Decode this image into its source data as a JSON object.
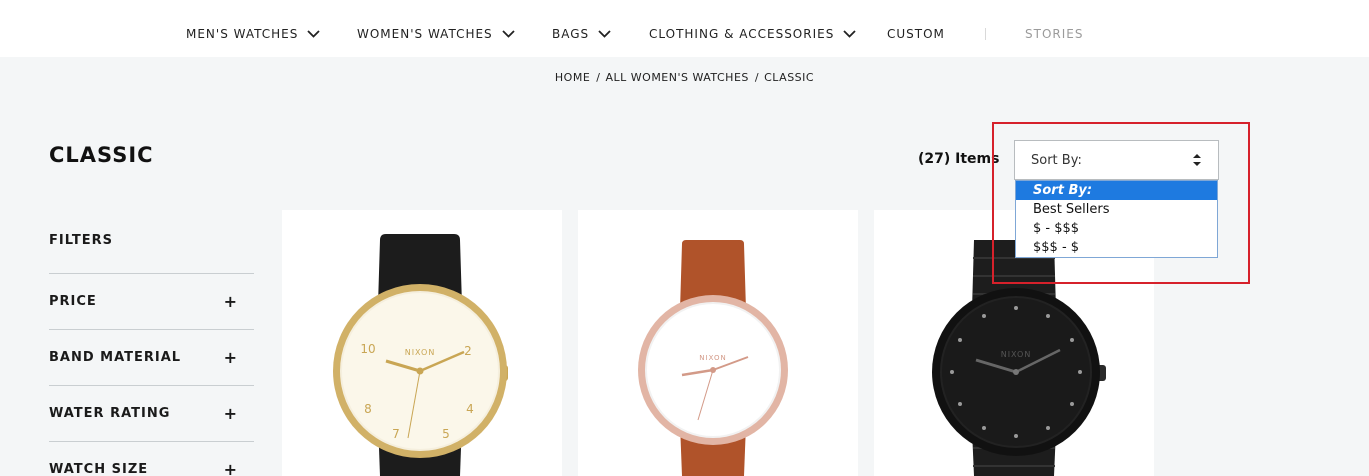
{
  "nav": {
    "items": [
      {
        "label": "MEN'S WATCHES",
        "has_dropdown": true
      },
      {
        "label": "WOMEN'S WATCHES",
        "has_dropdown": true
      },
      {
        "label": "BAGS",
        "has_dropdown": true
      },
      {
        "label": "CLOTHING & ACCESSORIES",
        "has_dropdown": true
      },
      {
        "label": "CUSTOM",
        "has_dropdown": false
      },
      {
        "label": "STORIES",
        "has_dropdown": false
      }
    ]
  },
  "breadcrumb": {
    "items": [
      "HOME",
      "ALL WOMEN'S WATCHES",
      "CLASSIC"
    ],
    "separator": "/"
  },
  "page": {
    "title": "CLASSIC",
    "item_count": "(27) Items"
  },
  "filters": {
    "title": "FILTERS",
    "items": [
      {
        "label": "PRICE",
        "icon": "plus-icon"
      },
      {
        "label": "BAND MATERIAL",
        "icon": "plus-icon"
      },
      {
        "label": "WATER RATING",
        "icon": "plus-icon"
      },
      {
        "label": "WATCH SIZE",
        "icon": "plus-icon"
      }
    ]
  },
  "sort": {
    "selected_label": "Sort By:",
    "options": [
      "Sort By:",
      "Best Sellers",
      "$ - $$$",
      "$$$ - $"
    ],
    "highlighted_option": "Sort By:"
  },
  "products": [
    {
      "brand": "NIXON",
      "strap": "black leather",
      "case": "gold",
      "dial": "white",
      "numerals": [
        "10",
        "2",
        "8",
        "4",
        "7",
        "5"
      ]
    },
    {
      "brand": "NIXON",
      "strap": "brown leather",
      "case": "rose gold",
      "dial": "white"
    },
    {
      "brand": "NIXON",
      "strap": "black steel",
      "case": "black",
      "dial": "black"
    }
  ],
  "colors": {
    "accent_highlight": "#d6212b",
    "select_blue": "#1e7ae0",
    "page_bg": "#f4f6f7"
  }
}
